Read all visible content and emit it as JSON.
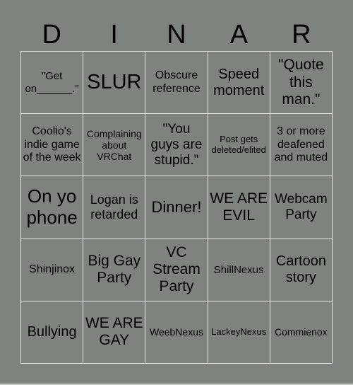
{
  "card": {
    "header_letters": [
      "D",
      "I",
      "N",
      "A",
      "R"
    ],
    "background_color": "#7f837f",
    "grid_line_color": "#e6e8e6",
    "rows": [
      [
        "\"Get on______.\"",
        "SLUR",
        "Obscure reference",
        "Speed moment",
        "\"Quote this man.\""
      ],
      [
        "Coolio's indie game of the week",
        "Complaining about VRChat",
        "\"You guys are stupid.\"",
        "Post gets deleted/elited",
        "3 or more deafened and muted"
      ],
      [
        "On yo phone",
        "Logan is retarded",
        "Dinner!",
        "WE ARE EVIL",
        "Webcam Party"
      ],
      [
        "Shinjinox",
        "Big Gay Party",
        "VC Stream Party",
        "ShillNexus",
        "Cartoon story"
      ],
      [
        "Bullying",
        "WE ARE GAY",
        "WeebNexus",
        "LackeyNexus",
        "Commienox"
      ]
    ]
  }
}
